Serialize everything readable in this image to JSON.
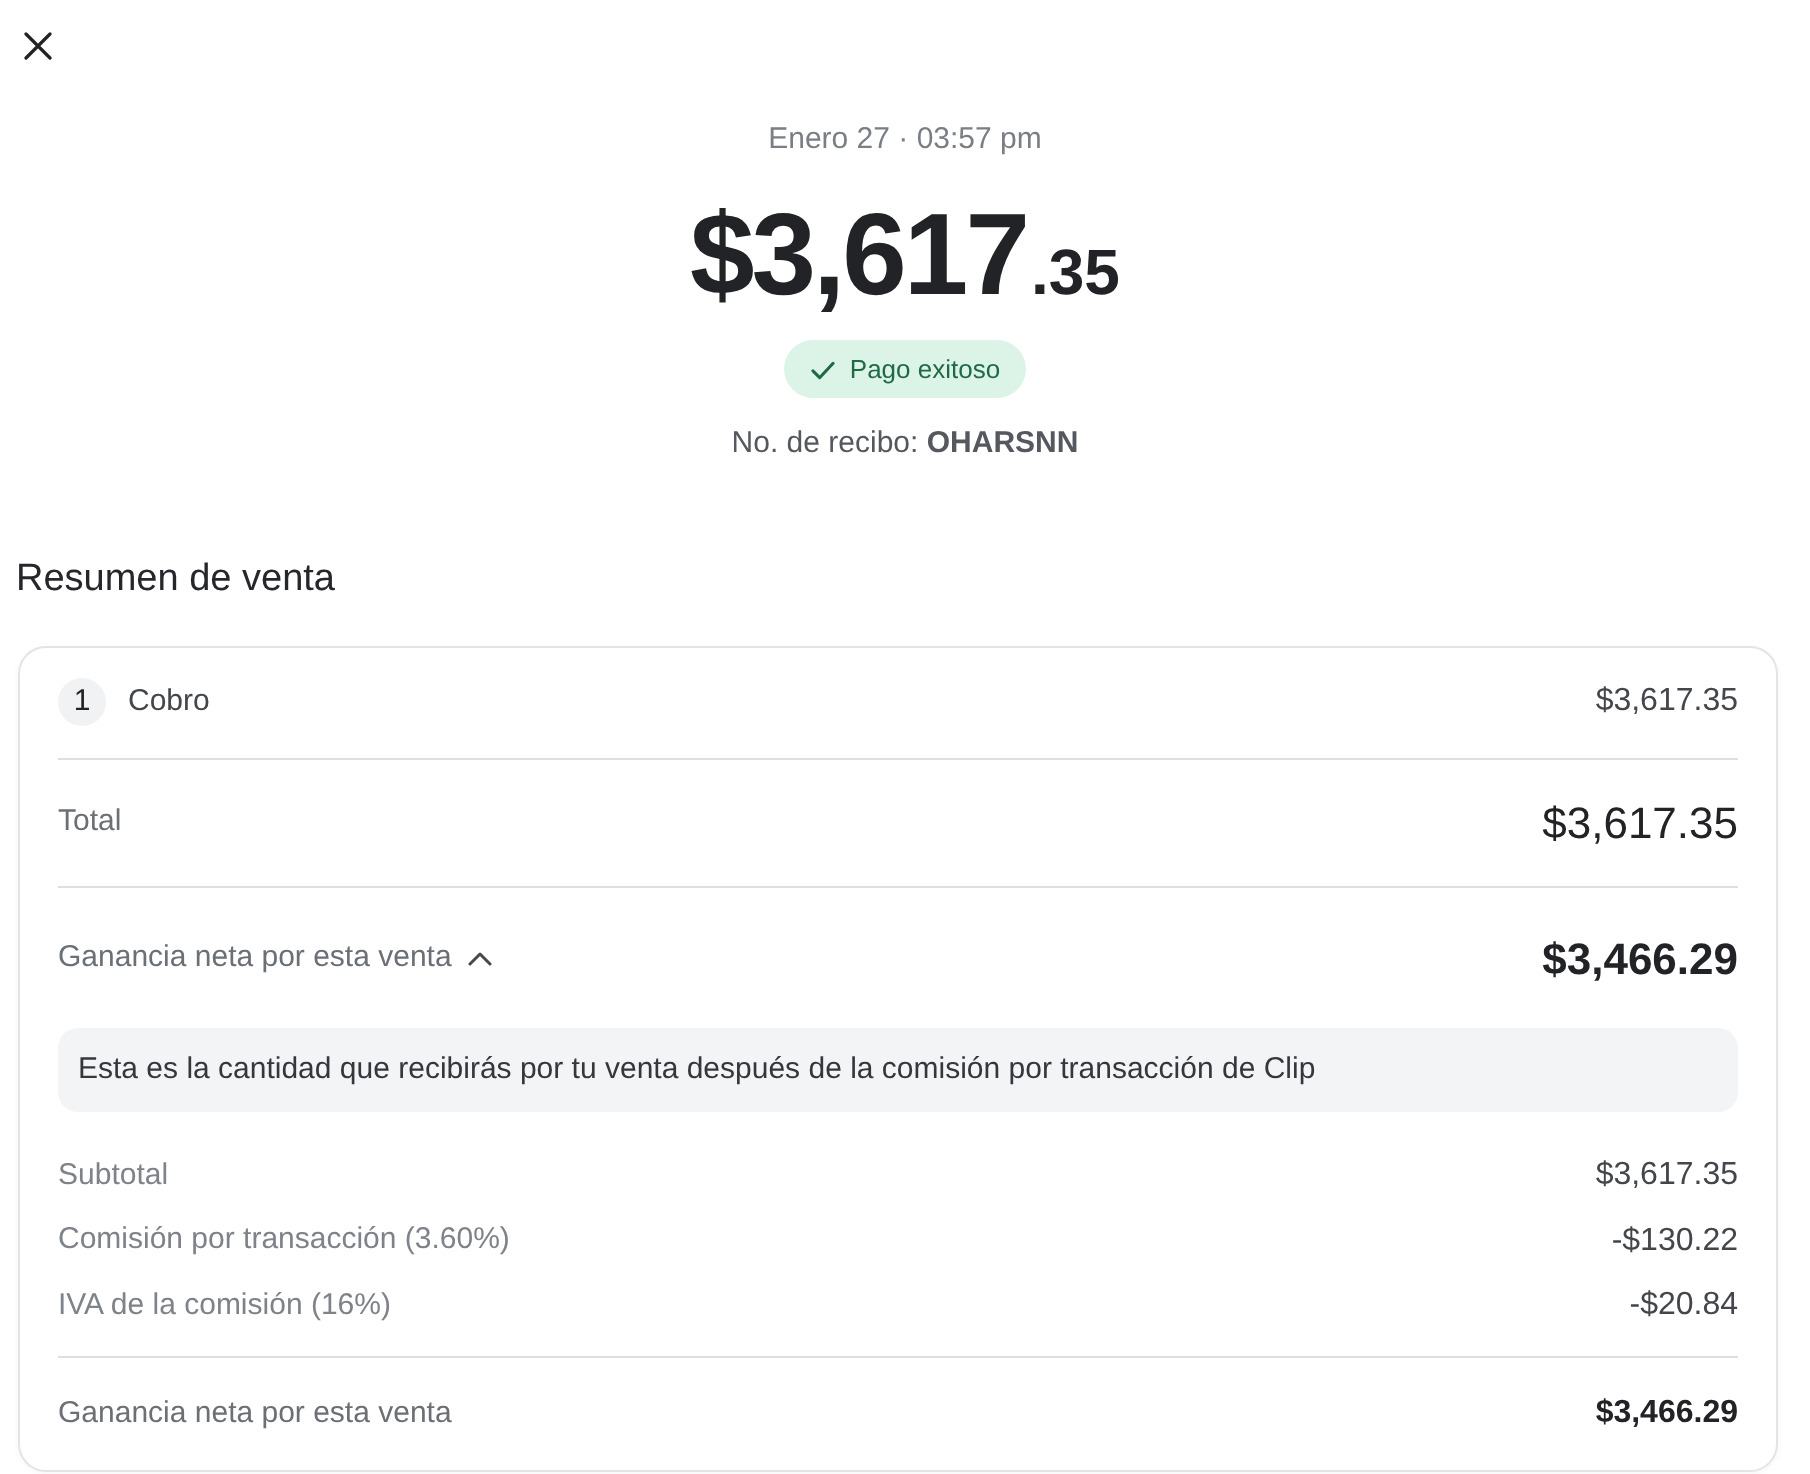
{
  "header": {
    "date": "Enero 27 · 03:57 pm",
    "amount_main": "$3,617",
    "amount_cents": ".35",
    "status_badge": {
      "kind": "success",
      "label": "Pago exitoso"
    },
    "receipt": "No. de recibo: **OHARSNN**"
  },
  "summary": {
    "title": "Resumen de venta",
    "items": [
      {
        "quantity": "1",
        "name": "Cobro",
        "amount": "$3,617.35"
      }
    ],
    "total": {
      "label": "Total",
      "amount": "$3,617.35"
    },
    "net_earnings": {
      "label": "Ganancia neta por esta venta",
      "amount": "$3,466.29",
      "expanded": true,
      "note": "Esta es la cantidad que recibirás por tu venta después de la comisión por transacción de Clip",
      "breakdown": [
        {
          "label": "Subtotal",
          "amount": "$3,617.35"
        },
        {
          "label": "Comisión por transacción (3.60%)",
          "amount": "-$130.22"
        },
        {
          "label": "IVA de la comisión (16%)",
          "amount": "-$20.84"
        }
      ],
      "footer": {
        "label": "Ganancia neta por esta venta",
        "amount": "$3,466.29"
      }
    }
  }
}
